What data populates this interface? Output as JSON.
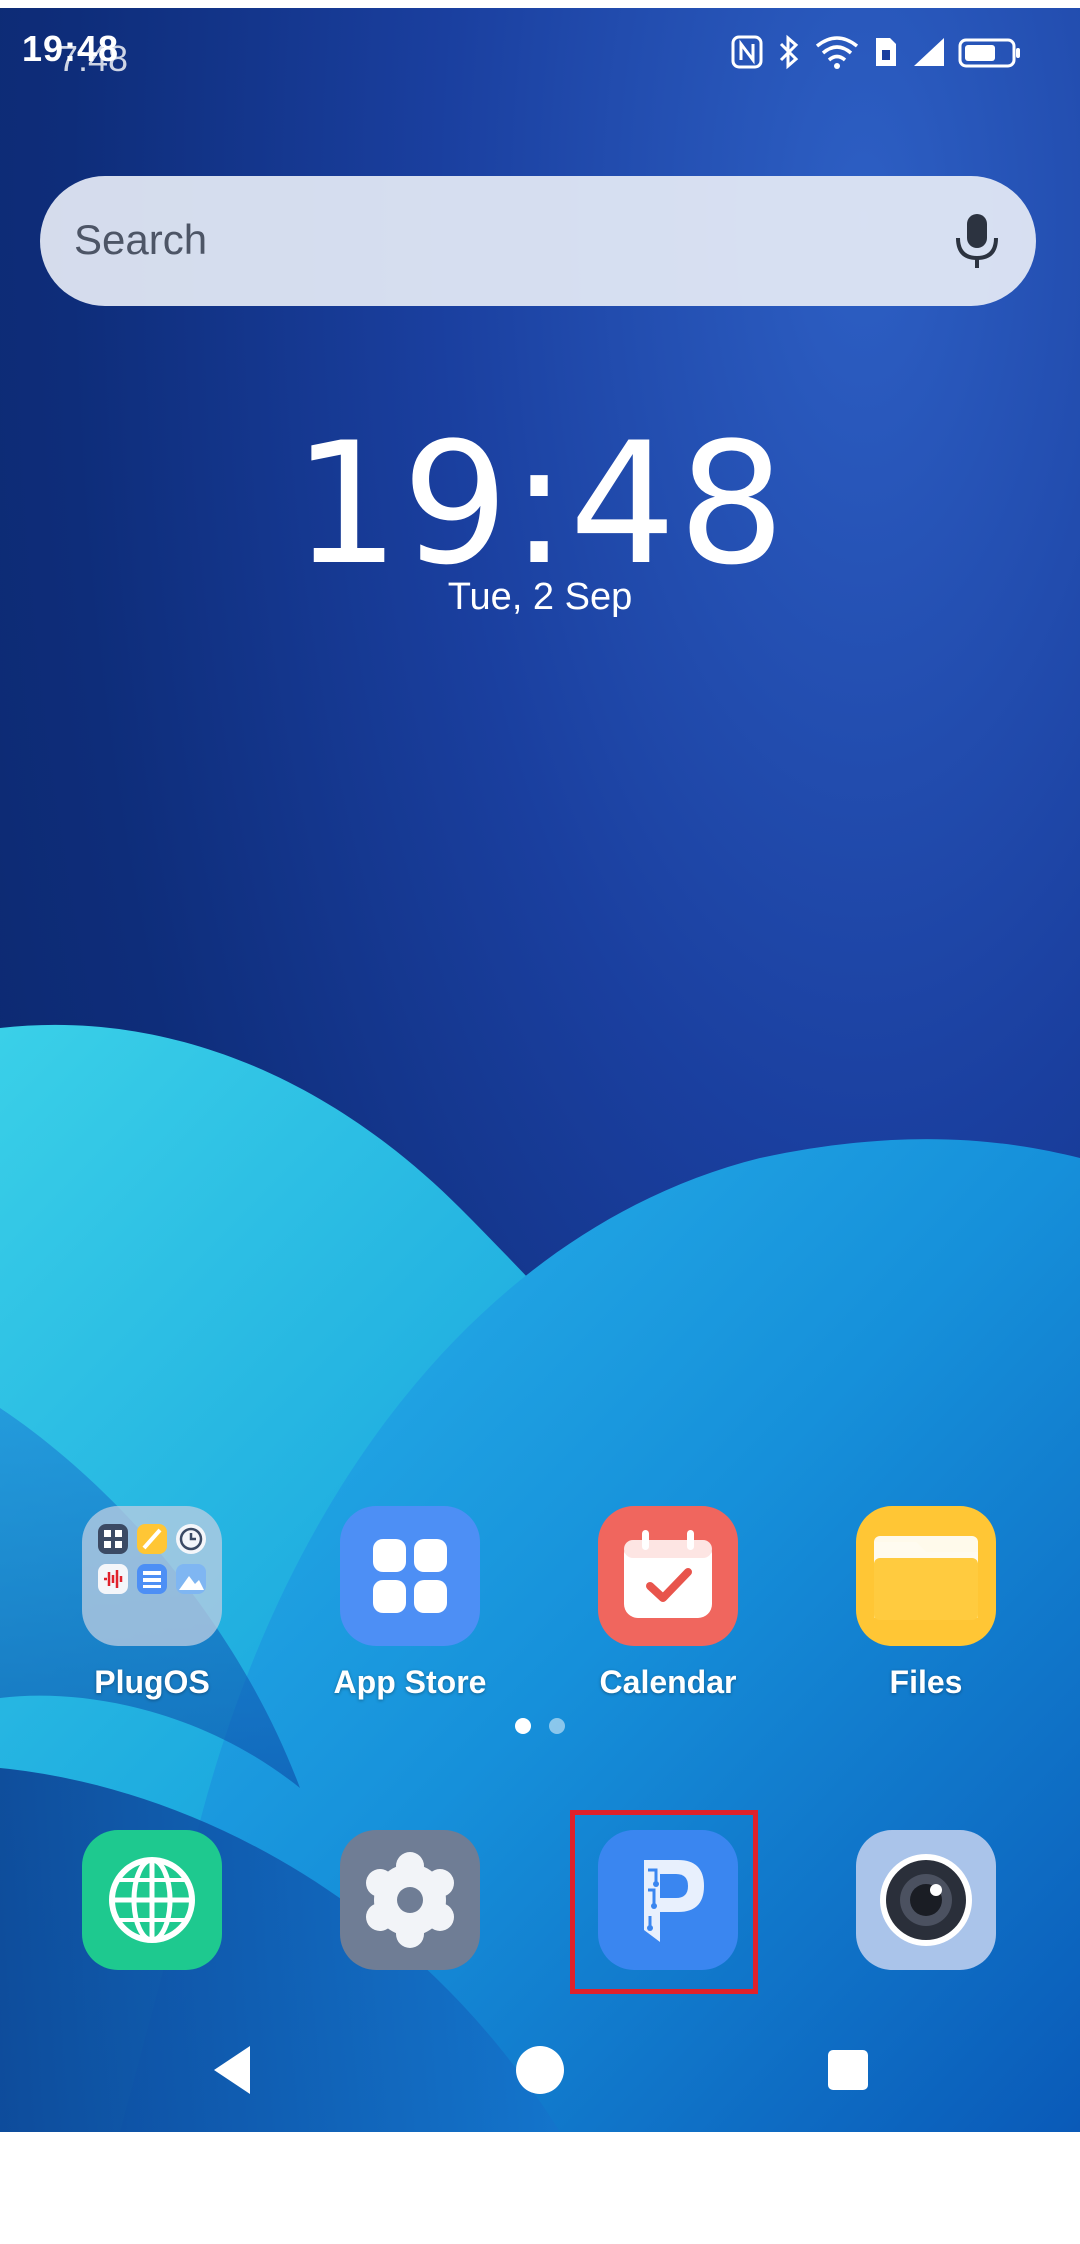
{
  "status_bar": {
    "time": "19:48",
    "time_ghost": "7:48",
    "icons": [
      "nfc-icon",
      "bluetooth-icon",
      "wifi-icon",
      "sim-icon",
      "signal-icon",
      "battery-icon"
    ]
  },
  "search": {
    "placeholder": "Search",
    "mic_icon": "microphone-icon"
  },
  "clock_widget": {
    "time": "19:48",
    "date": "Tue, 2 Sep"
  },
  "home_apps": [
    {
      "label": "PlugOS",
      "icon": "folder-icon"
    },
    {
      "label": "App Store",
      "icon": "app-store-icon"
    },
    {
      "label": "Calendar",
      "icon": "calendar-icon"
    },
    {
      "label": "Files",
      "icon": "files-folder-icon"
    }
  ],
  "page_indicator": {
    "pages": 2,
    "current": 1
  },
  "dock": [
    {
      "icon": "browser-globe-icon"
    },
    {
      "icon": "settings-gear-icon"
    },
    {
      "icon": "p-app-icon"
    },
    {
      "icon": "camera-icon"
    }
  ],
  "nav_bar": [
    "back-icon",
    "home-icon",
    "recents-icon"
  ],
  "colors": {
    "wallpaper_dark": "#0a2566",
    "wallpaper_light": "#2fc4e6",
    "highlight": "#e0212b",
    "app_store_bg": "#4d8ff5",
    "calendar_bg": "#f0665e",
    "files_bg": "#ffc635",
    "browser_bg": "#1ec98f",
    "settings_bg": "#6f7d95",
    "p_app_bg": "#3a86f0",
    "camera_bg": "#aac4ea"
  }
}
